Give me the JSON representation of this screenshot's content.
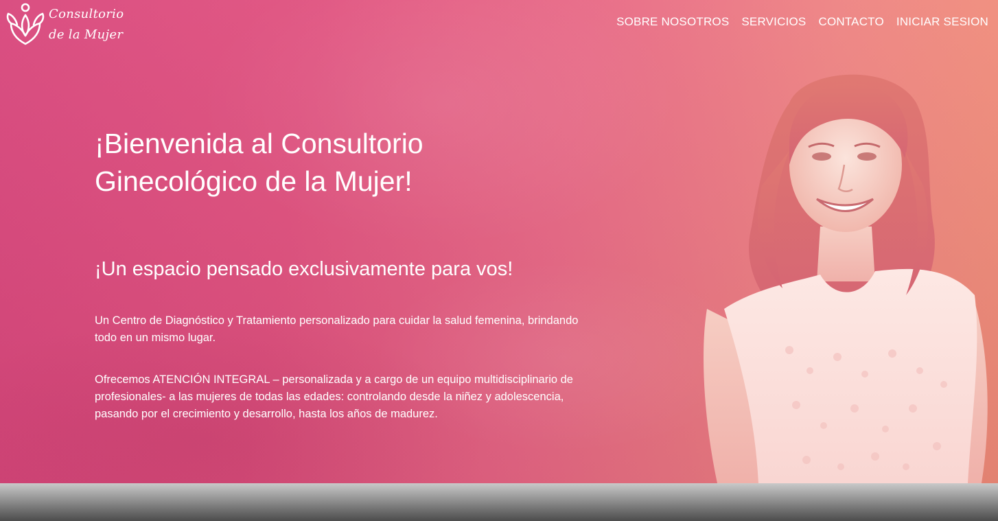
{
  "brand": {
    "line1": "Consultorio",
    "line2": "de la Mujer",
    "logo_icon": "lotus-flower-icon",
    "color": "#ffffff"
  },
  "nav": {
    "items": [
      {
        "label": "SOBRE NOSOTROS"
      },
      {
        "label": "SERVICIOS"
      },
      {
        "label": "CONTACTO"
      },
      {
        "label": "INICIAR SESION"
      }
    ]
  },
  "hero": {
    "title": "¡Bienvenida al Consultorio Ginecológico de la Mujer!",
    "subtitle": "¡Un espacio pensado exclusivamente para vos!",
    "paragraph1": "Un Centro de Diagnóstico y Tratamiento personalizado para cuidar la salud femenina, brindando todo en un mismo lugar.",
    "paragraph2": "Ofrecemos ATENCIÓN INTEGRAL – personalizada y a cargo de un equipo multidisciplinario de profesionales- a las mujeres de todas las edades: controlando desde la niñez y adolescencia, pasando por el crecimiento y desarrollo, hasta los años de madurez.",
    "colors": {
      "gradient_start": "#d9487d",
      "gradient_end": "#f19178",
      "text": "#ffffff"
    }
  }
}
